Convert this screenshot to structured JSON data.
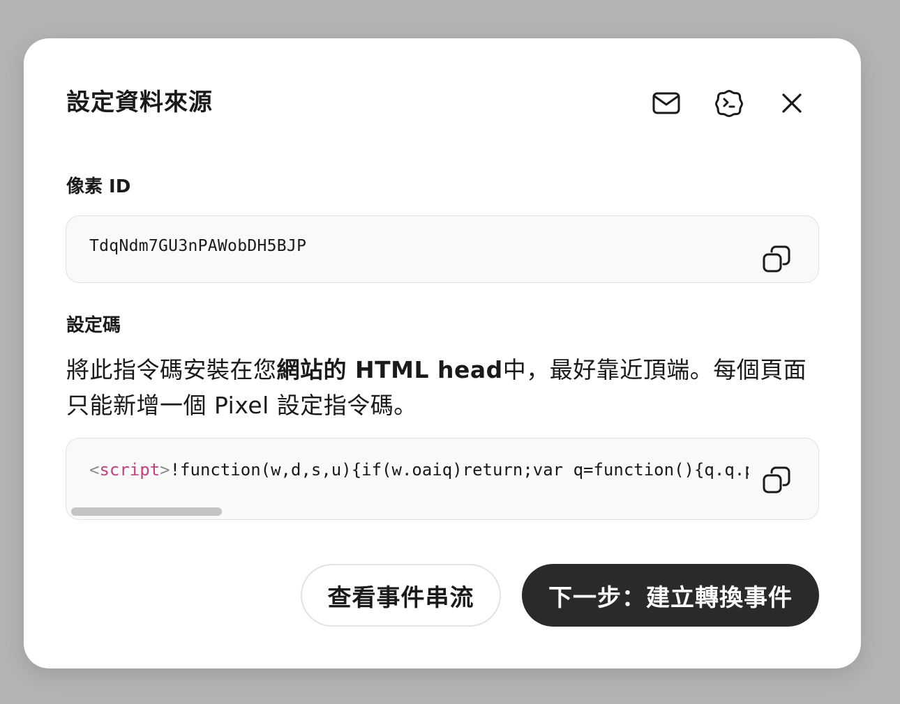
{
  "modal": {
    "title": "設定資料來源",
    "header_icons": [
      "mail-icon",
      "feedback-icon",
      "close-icon"
    ]
  },
  "pixel_id": {
    "label": "像素 ID",
    "value": "TdqNdm7GU3nPAWobDH5BJP"
  },
  "setup_code": {
    "label": "設定碼",
    "description_prefix": "將此指令碼安裝在您",
    "description_bold": "網站的 HTML head",
    "description_suffix": "中，最好靠近頂端。每個頁面只能新增一個 Pixel 設定指令碼。",
    "code_open_bracket": "<",
    "code_tag": "script",
    "code_close_bracket": ">",
    "code_body": "!function(w,d,s,u){if(w.oaiq)return;var q=function(){q.q.push(arguments)};"
  },
  "actions": {
    "secondary_label": "查看事件串流",
    "primary_label": "下一步：建立轉換事件"
  },
  "colors": {
    "primary_button": "#2a2a2a",
    "code_tag": "#c2417e",
    "backdrop": "#b3b3b3"
  }
}
